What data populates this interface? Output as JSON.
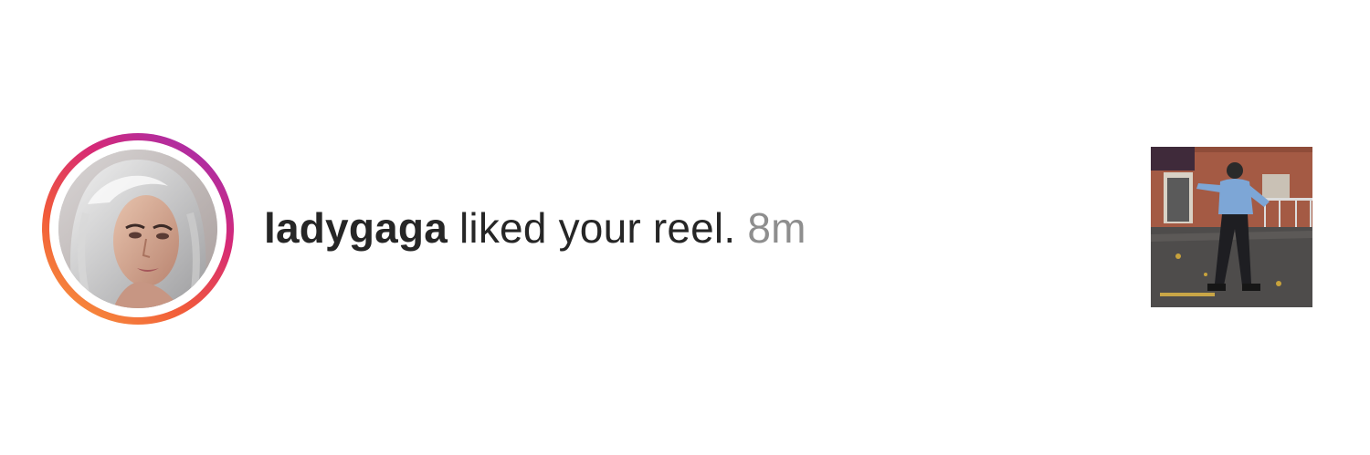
{
  "notification": {
    "username": "ladygaga",
    "action": " liked your reel.",
    "timestamp": " 8m"
  },
  "colors": {
    "text": "#262626",
    "timestamp": "#8e8e8e",
    "story_ring_start": "#f9a03c",
    "story_ring_end": "#962fbf"
  }
}
